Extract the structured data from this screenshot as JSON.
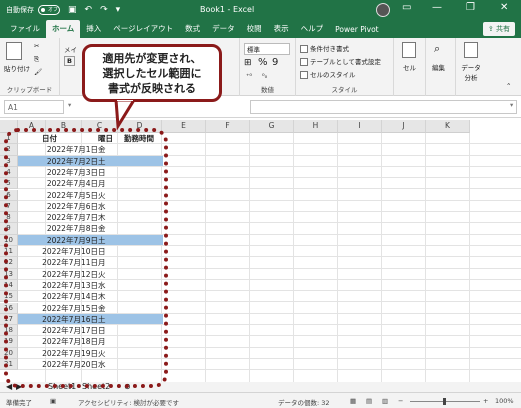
{
  "titlebar": {
    "autosave_label": "自動保存",
    "autosave_state": "オフ",
    "title": "Book1  -  Excel",
    "minimize": "—",
    "restore": "❐",
    "close": "✕"
  },
  "tabs": [
    "ファイル",
    "ホーム",
    "挿入",
    "ページレイアウト",
    "数式",
    "データ",
    "校閲",
    "表示",
    "ヘルプ",
    "Power Pivot"
  ],
  "share_label": "共有",
  "ribbon": {
    "clipboard_label": "クリップボード",
    "paste_label": "貼り付け",
    "font_fragment": "メイ",
    "number_format": "標準",
    "number_label": "数値",
    "percent": "%",
    "comma": "9",
    "cond_format": "条件付き書式",
    "table_format": "テーブルとして書式設定",
    "cell_style": "セルのスタイル",
    "style_label": "スタイル",
    "cells_label": "セル",
    "editing_label": "編集",
    "analyze_label": "データ分析"
  },
  "formula_bar": {
    "name_box": "A1"
  },
  "columns": [
    "A",
    "B",
    "C",
    "D",
    "E",
    "F",
    "G",
    "H",
    "I",
    "J",
    "K"
  ],
  "headers": {
    "date": "日付",
    "weekday": "曜日",
    "hours": "勤務時間"
  },
  "rows": [
    {
      "date": "2022年7月1日",
      "wd": "金",
      "hl": false
    },
    {
      "date": "2022年7月2日",
      "wd": "土",
      "hl": true
    },
    {
      "date": "2022年7月3日",
      "wd": "日",
      "hl": false
    },
    {
      "date": "2022年7月4日",
      "wd": "月",
      "hl": false
    },
    {
      "date": "2022年7月5日",
      "wd": "火",
      "hl": false
    },
    {
      "date": "2022年7月6日",
      "wd": "水",
      "hl": false
    },
    {
      "date": "2022年7月7日",
      "wd": "木",
      "hl": false
    },
    {
      "date": "2022年7月8日",
      "wd": "金",
      "hl": false
    },
    {
      "date": "2022年7月9日",
      "wd": "土",
      "hl": true
    },
    {
      "date": "2022年7月10日",
      "wd": "日",
      "hl": false
    },
    {
      "date": "2022年7月11日",
      "wd": "月",
      "hl": false
    },
    {
      "date": "2022年7月12日",
      "wd": "火",
      "hl": false
    },
    {
      "date": "2022年7月13日",
      "wd": "水",
      "hl": false
    },
    {
      "date": "2022年7月14日",
      "wd": "木",
      "hl": false
    },
    {
      "date": "2022年7月15日",
      "wd": "金",
      "hl": false
    },
    {
      "date": "2022年7月16日",
      "wd": "土",
      "hl": true
    },
    {
      "date": "2022年7月17日",
      "wd": "日",
      "hl": false
    },
    {
      "date": "2022年7月18日",
      "wd": "月",
      "hl": false
    },
    {
      "date": "2022年7月19日",
      "wd": "火",
      "hl": false
    },
    {
      "date": "2022年7月20日",
      "wd": "水",
      "hl": false
    }
  ],
  "row_numbers": [
    "1",
    "2",
    "3",
    "4",
    "5",
    "6",
    "7",
    "8",
    "9",
    "10",
    "11",
    "12",
    "13",
    "14",
    "15",
    "16",
    "17",
    "18",
    "19",
    "20",
    "21"
  ],
  "callout": [
    "適用先が変更され、",
    "選択したセル範囲に",
    "書式が反映される"
  ],
  "sheet_tabs": [
    "Sheet1",
    "Sheet2"
  ],
  "status": {
    "ready": "準備完了",
    "accessibility": "アクセシビリティ: 検討が必要です",
    "count": "データの個数: 32",
    "zoom": "100%"
  },
  "colors": {
    "excel_green": "#217346",
    "highlight": "#9dc3e6",
    "callout_border": "#8b1a1a"
  }
}
